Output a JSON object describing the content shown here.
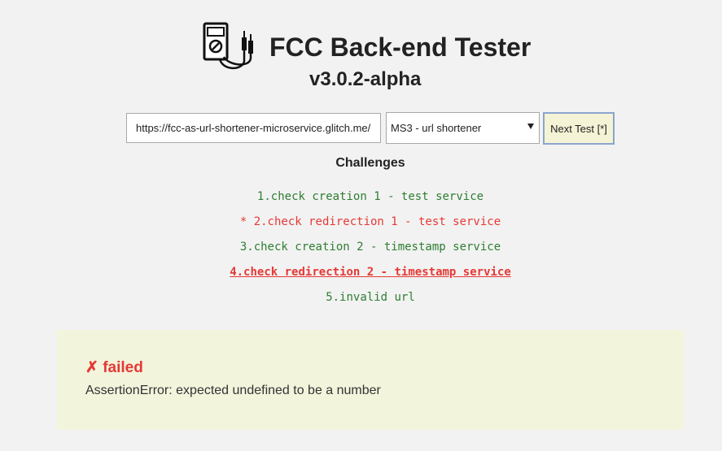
{
  "header": {
    "logo_icon": "multimeter-icon",
    "title": "FCC Back-end Tester",
    "version": "v3.0.2-alpha"
  },
  "controls": {
    "url_value": "https://fcc-as-url-shortener-microservice.glitch.me/",
    "select_value": "MS3 - url shortener",
    "next_label": "Next Test [*]"
  },
  "challenges": {
    "heading": "Challenges",
    "items": [
      {
        "marker": "",
        "label": "1.check creation 1 - test service",
        "status": "passed"
      },
      {
        "marker": "* ",
        "label": "2.check redirection 1 - test service",
        "status": "failed"
      },
      {
        "marker": "",
        "label": "3.check creation 2 - timestamp service",
        "status": "passed"
      },
      {
        "marker": "",
        "label": "4.check redirection 2 - timestamp service",
        "status": "current"
      },
      {
        "marker": "",
        "label": "5.invalid url",
        "status": "passed"
      }
    ]
  },
  "result": {
    "status": "✗ failed",
    "message": "AssertionError: expected undefined to be a number"
  },
  "colors": {
    "pass": "#2e7d32",
    "fail": "#e53935",
    "result_bg": "#f3f4dc",
    "button_bg": "#f5f3d6"
  }
}
